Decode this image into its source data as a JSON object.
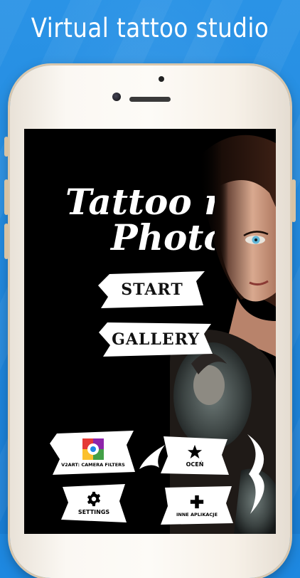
{
  "headline": "Virtual tattoo studio",
  "app": {
    "logo_line1": "Tattoo my",
    "logo_line2": "Photo"
  },
  "menu": {
    "start_label": "START",
    "gallery_label": "GALLERY"
  },
  "tiles": {
    "camera_filters_label": "V2ART: CAMERA FILTERS",
    "rate_label": "OCEŃ",
    "settings_label": "SETTINGS",
    "other_apps_label": "INNE APLIKACJE"
  },
  "colors": {
    "background": "#1e88e0",
    "phone_body": "#fbf8f3",
    "screen": "#000000",
    "button_fill": "#ffffff"
  },
  "icons": {
    "camera_filters": "camera-filters-app-icon",
    "rate": "star-icon",
    "settings": "gear-icon",
    "other_apps": "plus-icon"
  }
}
